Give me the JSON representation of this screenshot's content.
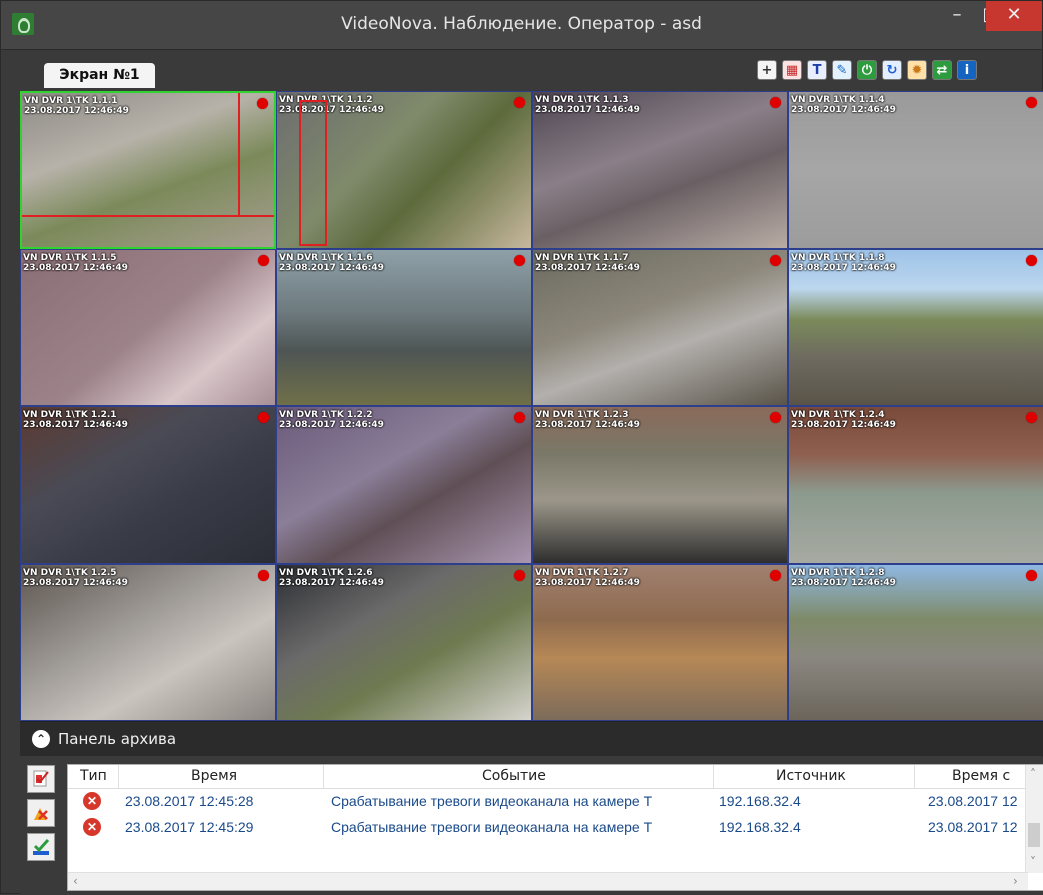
{
  "window": {
    "title": "VideoNova. Наблюдение. Оператор - asd",
    "min_glyph": "–",
    "max_glyph": "□",
    "close_glyph": "✕"
  },
  "toolbar": {
    "screen_tab_label": "Экран №1",
    "icons": [
      {
        "name": "add-icon",
        "glyph": "+",
        "bg": "#f4f4f4",
        "color": "#333"
      },
      {
        "name": "grid-alert-icon",
        "glyph": "▦",
        "bg": "#fbe3e3",
        "color": "#c62828"
      },
      {
        "name": "text-icon",
        "glyph": "T",
        "bg": "#e8eefc",
        "color": "#1e3fa8"
      },
      {
        "name": "brush-icon",
        "glyph": "✎",
        "bg": "#e3f2fd",
        "color": "#1565c0"
      },
      {
        "name": "monitor-icon",
        "glyph": "⏻",
        "bg": "#2e9b3e",
        "color": "#ffffff"
      },
      {
        "name": "refresh-icon",
        "glyph": "↻",
        "bg": "#e3efff",
        "color": "#1e5fd0"
      },
      {
        "name": "settings-icon",
        "glyph": "✹",
        "bg": "#ffe0a8",
        "color": "#c9781a"
      },
      {
        "name": "switch-icon",
        "glyph": "⇄",
        "bg": "#2e9b3e",
        "color": "#ffffff"
      },
      {
        "name": "info-icon",
        "glyph": "i",
        "bg": "#1565c0",
        "color": "#ffffff"
      }
    ]
  },
  "cameras": [
    {
      "name": "VN DVR 1\\TK 1.1.1",
      "time": "23.08.2017 12:46:49",
      "bg": "linear-gradient(160deg,#8d8a86 0%,#b7b2a9 35%,#7b8a5a 60%,#a89f91 100%)"
    },
    {
      "name": "VN DVR 1\\TK 1.1.2",
      "time": "23.08.2017 12:46:49",
      "bg": "linear-gradient(135deg,#6d6d70 0%,#7f8a6a 40%,#5c6a3c 60%,#c7b89d 100%)"
    },
    {
      "name": "VN DVR 1\\TK 1.1.3",
      "time": "23.08.2017 12:46:49",
      "bg": "linear-gradient(160deg,#4d4450 0%,#8a7f88 40%,#6a6064 60%,#b8aca4 100%)"
    },
    {
      "name": "VN DVR 1\\TK 1.1.4",
      "time": "23.08.2017 12:46:49",
      "bg": "linear-gradient(180deg,#9a9a9a 0%,#a6a6a6 50%,#9c9c9c 100%)"
    },
    {
      "name": "VN DVR 1\\TK 1.1.5",
      "time": "23.08.2017 12:46:49",
      "bg": "linear-gradient(140deg,#8a6e76 0%,#9c8289 50%,#d8c6c9 75%,#a88f96 100%)"
    },
    {
      "name": "VN DVR 1\\TK 1.1.6",
      "time": "23.08.2017 12:46:49",
      "bg": "linear-gradient(180deg,#8ea0a8 0%,#6d7a7e 40%,#4e5554 65%,#6f7048 100%)"
    },
    {
      "name": "VN DVR 1\\TK 1.1.7",
      "time": "23.08.2017 12:46:49",
      "bg": "linear-gradient(160deg,#6b6a60 0%,#8c877a 40%,#b3b0ad 60%,#5a5449 100%)"
    },
    {
      "name": "VN DVR 1\\TK 1.1.8",
      "time": "23.08.2017 12:46:49",
      "bg": "linear-gradient(180deg,#9ec3e8 0%,#bcd6ee 25%,#7b8a5a 45%,#6e6a60 70%,#5a5448 100%)"
    },
    {
      "name": "VN DVR 1\\TK 1.2.1",
      "time": "23.08.2017 12:46:49",
      "bg": "linear-gradient(150deg,#5b3a30 0%,#4a4a55 35%,#3a3d48 60%,#2b2d36 100%)"
    },
    {
      "name": "VN DVR 1\\TK 1.2.2",
      "time": "23.08.2017 12:46:49",
      "bg": "linear-gradient(150deg,#6a5a7a 0%,#8a7e98 40%,#5f4f55 60%,#a996b0 100%)"
    },
    {
      "name": "VN DVR 1\\TK 1.2.3",
      "time": "23.08.2017 12:46:49",
      "bg": "linear-gradient(180deg,#8a6a5a 0%,#7a7868 30%,#9b9689 60%,#2e2e2e 100%)"
    },
    {
      "name": "VN DVR 1\\TK 1.2.4",
      "time": "23.08.2017 12:46:49",
      "bg": "linear-gradient(180deg,#7a4a3a 0%,#8e5e4e 30%,#8c9a8e 55%,#a7aaa2 100%)"
    },
    {
      "name": "VN DVR 1\\TK 1.2.5",
      "time": "23.08.2017 12:46:49",
      "bg": "linear-gradient(150deg,#5d5550 0%,#9e9a96 40%,#c9c4be 65%,#8a8580 100%)"
    },
    {
      "name": "VN DVR 1\\TK 1.2.6",
      "time": "23.08.2017 12:46:49",
      "bg": "linear-gradient(150deg,#2c2e33 0%,#6b6a6a 35%,#6e7a50 60%,#d6d4ce 100%)"
    },
    {
      "name": "VN DVR 1\\TK 1.2.7",
      "time": "23.08.2017 12:46:49",
      "bg": "linear-gradient(180deg,#a08070 0%,#8e6a4e 35%,#b68856 60%,#7c6b5a 100%)"
    },
    {
      "name": "VN DVR 1\\TK 1.2.8",
      "time": "23.08.2017 12:46:49",
      "bg": "linear-gradient(180deg,#8fb8e2 0%,#7e8a68 35%,#8a8780 60%,#6b655b 100%)"
    }
  ],
  "archive": {
    "toggle_glyph": "⌃",
    "title": "Панель архива",
    "columns": [
      "Тип",
      "Время",
      "Событие",
      "Источник",
      "Время с"
    ],
    "rows": [
      {
        "time": "23.08.2017 12:45:28",
        "event": "Срабатывание тревоги видеоканала на камере Т",
        "source": "192.168.32.4",
        "time2": "23.08.2017 12"
      },
      {
        "time": "23.08.2017 12:45:29",
        "event": "Срабатывание тревоги видеоканала на камере Т",
        "source": "192.168.32.4",
        "time2": "23.08.2017 12"
      }
    ],
    "side_buttons": [
      "check-report-icon",
      "clear-report-icon",
      "confirm-report-icon"
    ]
  }
}
